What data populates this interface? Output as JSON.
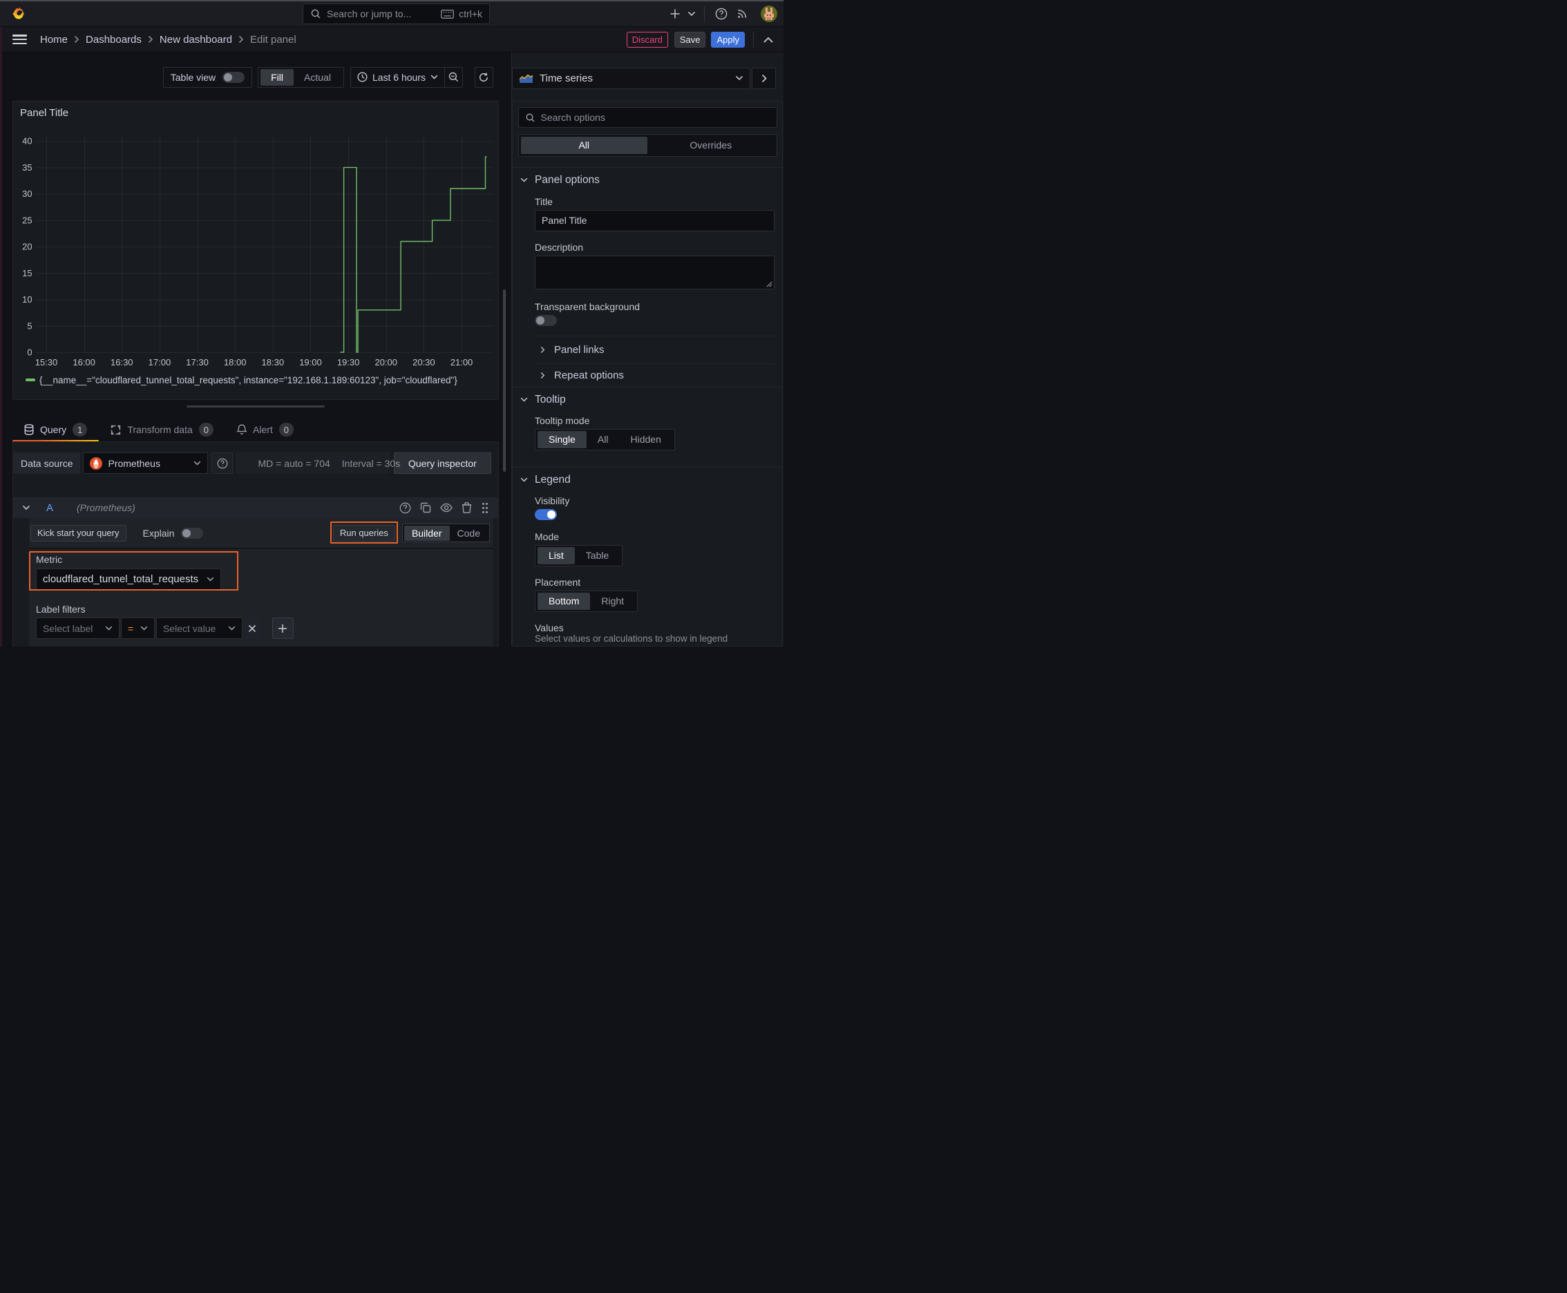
{
  "colors": {
    "accent_blue": "#3d71d9",
    "series_green": "#73bf69",
    "annotation_orange": "#e8632c",
    "discard_pink": "#f0437a",
    "equals_orange": "#ff9830",
    "tab_gradient": [
      "#f05a28",
      "#fbca0a"
    ],
    "prometheus_orange": "#e6522c"
  },
  "header": {
    "search": {
      "placeholder": "Search or jump to...",
      "shortcut": "ctrl+k"
    }
  },
  "breadcrumb": {
    "items": [
      "Home",
      "Dashboards",
      "New dashboard"
    ],
    "current": "Edit panel"
  },
  "actions": {
    "discard": "Discard",
    "save": "Save",
    "apply": "Apply"
  },
  "toolbar": {
    "table_view": "Table view",
    "fill": "Fill",
    "actual": "Actual",
    "time_range": "Last 6 hours"
  },
  "viz_picker": {
    "name": "Time series"
  },
  "panel": {
    "title": "Panel Title"
  },
  "chart_data": {
    "type": "line",
    "title": "Panel Title",
    "x_ticks": [
      {
        "minute": 0,
        "label": "15:30"
      },
      {
        "minute": 30,
        "label": "16:00"
      },
      {
        "minute": 60,
        "label": "16:30"
      },
      {
        "minute": 90,
        "label": "17:00"
      },
      {
        "minute": 120,
        "label": "17:30"
      },
      {
        "minute": 150,
        "label": "18:00"
      },
      {
        "minute": 180,
        "label": "18:30"
      },
      {
        "minute": 210,
        "label": "19:00"
      },
      {
        "minute": 240,
        "label": "19:30"
      },
      {
        "minute": 270,
        "label": "20:00"
      },
      {
        "minute": 300,
        "label": "20:30"
      },
      {
        "minute": 330,
        "label": "21:00"
      }
    ],
    "y_ticks": [
      0,
      5,
      10,
      15,
      20,
      25,
      30,
      35,
      40
    ],
    "ylim": [
      0,
      40
    ],
    "x_domain_minutes": [
      -9,
      356
    ],
    "grid": true,
    "legend_position": "bottom",
    "series": [
      {
        "name": "{__name__=\"cloudflared_tunnel_total_requests\", instance=\"192.168.1.189:60123\", job=\"cloudflared\"}",
        "color": "#73bf69",
        "step_points": [
          [
            233.6,
            0
          ],
          [
            236.4,
            35
          ],
          [
            246.5,
            0
          ],
          [
            247.6,
            8
          ],
          [
            281.7,
            21
          ],
          [
            306.7,
            25
          ],
          [
            321.2,
            31
          ],
          [
            348.9,
            37
          ]
        ],
        "end_minute": 350
      }
    ]
  },
  "query_section": {
    "tabs": [
      {
        "label": "Query",
        "count": "1"
      },
      {
        "label": "Transform data",
        "count": "0"
      },
      {
        "label": "Alert",
        "count": "0"
      }
    ],
    "datasource": {
      "label": "Data source",
      "name": "Prometheus",
      "stat_md": "MD = auto = 704",
      "stat_interval": "Interval = 30s",
      "inspector": "Query inspector"
    },
    "row": {
      "ref_id": "A",
      "ds_hint": "(Prometheus)"
    },
    "editor": {
      "kickstart": "Kick start your query",
      "explain": "Explain",
      "run": "Run queries",
      "builder": "Builder",
      "code": "Code",
      "metric_label": "Metric",
      "metric_value": "cloudflared_tunnel_total_requests",
      "label_filters": "Label filters",
      "select_label": "Select label",
      "operator": "=",
      "select_value": "Select value"
    }
  },
  "options": {
    "search_placeholder": "Search options",
    "tab_all": "All",
    "tab_overrides": "Overrides",
    "panel_options": {
      "heading": "Panel options",
      "title_label": "Title",
      "title_value": "Panel Title",
      "description_label": "Description",
      "transparent_label": "Transparent background",
      "links": "Panel links",
      "repeat": "Repeat options"
    },
    "tooltip": {
      "heading": "Tooltip",
      "mode_label": "Tooltip mode",
      "modes": [
        "Single",
        "All",
        "Hidden"
      ],
      "selected": "Single"
    },
    "legend": {
      "heading": "Legend",
      "visibility_label": "Visibility",
      "mode_label": "Mode",
      "modes": [
        "List",
        "Table"
      ],
      "selected_mode": "List",
      "placement_label": "Placement",
      "placements": [
        "Bottom",
        "Right"
      ],
      "selected_placement": "Bottom",
      "values_label": "Values",
      "values_help": "Select values or calculations to show in legend"
    }
  }
}
